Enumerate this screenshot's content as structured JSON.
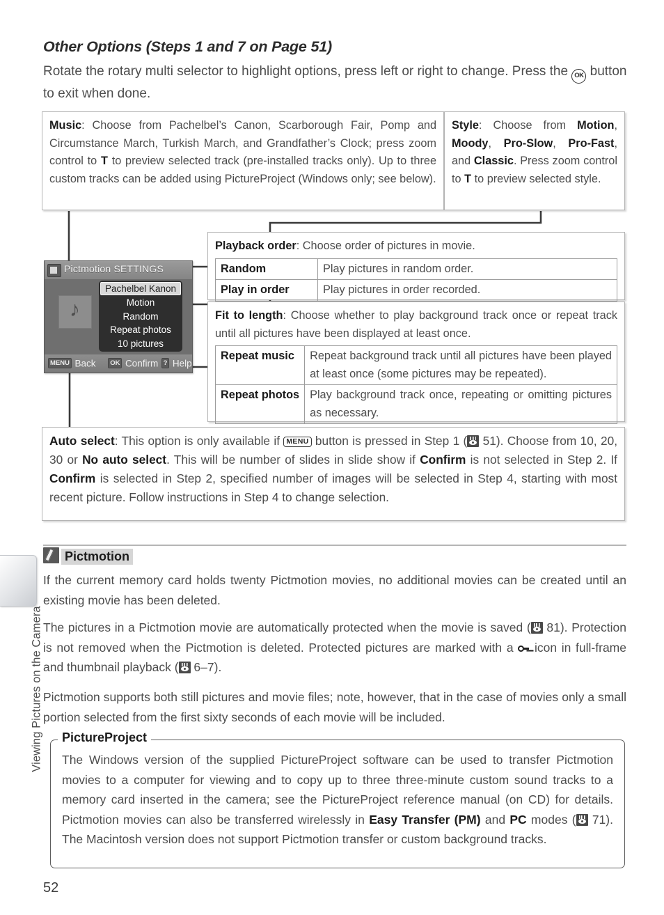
{
  "page": {
    "number": "52",
    "chapter": "Viewing Pictures on the Camera"
  },
  "section": {
    "title": "Other Options (Steps 1 and 7 on Page 51)",
    "intro_before_ok": "Rotate the rotary multi selector to highlight options, press left or right to change. Press the ",
    "intro_after_ok": " button to exit when done.",
    "ok_icon": "ok-button-icon"
  },
  "music_box": {
    "term": "Music",
    "text_1": ": Choose from Pachelbel’s Canon, Scarborough Fair, Pomp and Circumstance March, Turkish March, and Grandfather’s Clock; press zoom control to ",
    "tele": "T",
    "text_2": " to preview selected track (pre-installed tracks only).  Up to three custom tracks can be added using PictureProject (Windows only; see below)."
  },
  "style_box": {
    "term": "Style",
    "text_1": ": Choose from ",
    "opt_1": "Motion",
    "sep_1": ", ",
    "opt_2": "Moody",
    "sep_2": ", ",
    "opt_3": "Pro-Slow",
    "sep_3": ", ",
    "opt_4": "Pro-Fast",
    "sep_4": ", and ",
    "opt_5": "Classic",
    "text_2": ".  Press zoom control to ",
    "tele": "T",
    "text_3": " to preview selected style."
  },
  "playback_box": {
    "term": "Playback order",
    "text": ": Choose order of pictures in movie.",
    "rows": [
      {
        "key": "Random",
        "desc": "Play pictures in random order."
      },
      {
        "key": "Play in order",
        "desc": "Play pictures in order recorded."
      }
    ]
  },
  "fit_box": {
    "term": "Fit to length",
    "text": ": Choose whether to play background track once or repeat track until all pictures have been displayed at least once.",
    "rows": [
      {
        "key": "Repeat music",
        "desc": "Repeat background track until all pictures have been played at least once (some pictures may be repeated)."
      },
      {
        "key": "Repeat photos",
        "desc": "Play background track once, repeating or omitting pictures as necessary."
      }
    ]
  },
  "auto_box": {
    "term": "Auto select",
    "text_1": ": This option is only available if ",
    "menu_icon": "menu-button-icon",
    "text_2": " button is pressed in Step 1 (",
    "ref_icon": "page-reference-icon",
    "ref_page": " 51).  Choose from 10, 20, 30 or ",
    "bold_1": "No auto select",
    "text_3": ".  This will be number of slides in slide show if ",
    "bold_2": "Confirm",
    "text_4": " is not selected in Step 2.  If ",
    "bold_3": "Confirm",
    "text_5": " is selected in Step 2, specified number of images will be selected in Step 4, starting with most recent picture.  Follow instructions in Step 4 to change selection."
  },
  "lcd": {
    "title": "Pictmotion SETTINGS",
    "thumb_icon": "music-note-icon",
    "header_icon": "playback-mode-icon",
    "items": [
      {
        "label": "Pachelbel Kanon",
        "selected": true
      },
      {
        "label": "Motion",
        "selected": false
      },
      {
        "label": "Random",
        "selected": false
      },
      {
        "label": "Repeat photos",
        "selected": false
      },
      {
        "label": "10 pictures",
        "selected": false
      }
    ],
    "footer": {
      "menu_badge": "MENU",
      "menu_label": "Back",
      "ok_badge": "OK",
      "ok_label": "Confirm",
      "help_badge": "?",
      "help_label": "Help"
    }
  },
  "note": {
    "icon": "pencil-note-icon",
    "title": "Pictmotion",
    "p1": "If the current memory card holds twenty Pictmotion movies, no additional movies can be created until an existing movie has been deleted.",
    "p2_a": "The pictures in a Pictmotion movie are automatically protected when the movie is saved (",
    "p2_ref1": "page-reference-icon",
    "p2_b": " 81).  Protection is not removed when the Pictmotion is deleted.  Protected pictures are marked with a ",
    "p2_key": "protect-key-icon",
    "p2_c": " icon in full-frame and thumbnail playback (",
    "p2_ref2": "page-reference-icon",
    "p2_d": " 6–7).",
    "p3": "Pictmotion supports both still pictures and movie files; note, however, that in the case of movies only a small portion selected from the first sixty seconds of each movie will be included."
  },
  "pictureproject": {
    "legend": "PictureProject",
    "text_1": "The Windows version of the supplied PictureProject software can be used to transfer Pictmotion movies to a computer for viewing and to copy up to three three-minute custom sound tracks to a memory card inserted in the camera; see the PictureProject reference manual (on CD) for details.  Pictmotion movies can also be transferred wirelessly in ",
    "bold_1": "Easy Transfer (PM)",
    "text_2": " and ",
    "bold_2": "PC",
    "text_3": " modes (",
    "ref_icon": "page-reference-icon",
    "text_4": " 71). The Macintosh version does not support Pictmotion transfer or custom background tracks."
  },
  "colors": {
    "body_text": "#4d4d4d",
    "bold_text": "#1b1b1b",
    "box_border": "#b3b3b3",
    "table_border": "#9c9c9c",
    "lcd_bg": "#6f6f6f",
    "note_highlight": "#d6d6d6"
  }
}
